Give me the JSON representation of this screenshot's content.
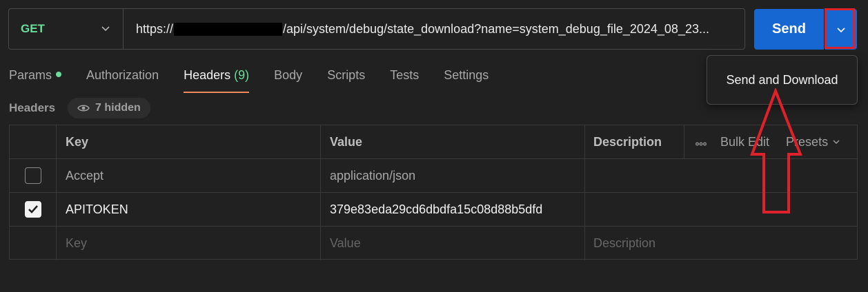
{
  "request": {
    "method": "GET",
    "url_prefix": "https://",
    "url_path": "/api/system/debug/state_download?name=system_debug_file_2024_08_23..."
  },
  "send": {
    "label": "Send",
    "menu_item": "Send and Download"
  },
  "tabs": [
    {
      "label": "Params",
      "indicator": true
    },
    {
      "label": "Authorization"
    },
    {
      "label": "Headers",
      "count": "(9)",
      "active": true
    },
    {
      "label": "Body"
    },
    {
      "label": "Scripts"
    },
    {
      "label": "Tests"
    },
    {
      "label": "Settings"
    }
  ],
  "headers_section": {
    "label": "Headers",
    "hidden_label": "7 hidden"
  },
  "table": {
    "columns": {
      "key": "Key",
      "value": "Value",
      "description": "Description"
    },
    "tools": {
      "bulk_edit": "Bulk Edit",
      "presets": "Presets"
    },
    "rows": [
      {
        "checked": false,
        "key": "Accept",
        "value": "application/json",
        "description": ""
      },
      {
        "checked": true,
        "key": "APITOKEN",
        "value": "379e83eda29cd6dbdfa15c08d88b5dfd",
        "description": ""
      }
    ],
    "placeholders": {
      "key": "Key",
      "value": "Value",
      "description": "Description"
    }
  },
  "colors": {
    "accent": "#1767d3",
    "method_get": "#6bdd9a",
    "highlight": "#e0202a",
    "tab_underline": "#f08a5d"
  }
}
